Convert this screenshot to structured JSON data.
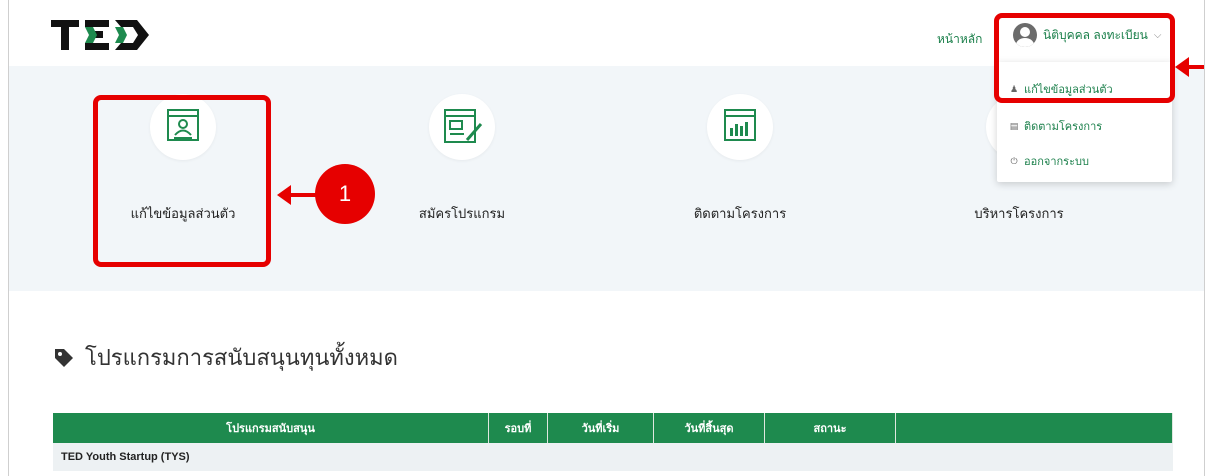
{
  "header": {
    "logo_text": "TED",
    "home_link": "หน้าหลัก",
    "user_name": "นิติบุคคล ลงทะเบียน",
    "user_chevron": "⌵"
  },
  "dropdown": {
    "items": [
      {
        "icon": "user-icon",
        "label": "แก้ไขข้อมูลส่วนตัว"
      },
      {
        "icon": "list-icon",
        "label": "ติดตามโครงการ"
      },
      {
        "icon": "power-icon",
        "label": "ออกจากระบบ"
      }
    ]
  },
  "quick_actions": [
    {
      "icon": "profile-card-icon",
      "label": "แก้ไขข้อมูลส่วนตัว"
    },
    {
      "icon": "edit-form-icon",
      "label": "สมัครโปรแกรม"
    },
    {
      "icon": "chart-board-icon",
      "label": "ติดตามโครงการ"
    },
    {
      "icon": "manage-icon",
      "label": "บริหารโครงการ"
    }
  ],
  "section": {
    "title": "โปรแกรมการสนับสนุนทุนทั้งหมด",
    "icon": "tag-icon"
  },
  "table": {
    "headers": [
      "โปรแกรมสนับสนุน",
      "รอบที่",
      "วันที่เริ่ม",
      "วันที่สิ้นสุด",
      "สถานะ",
      ""
    ],
    "group_row": "TED Youth Startup (TYS)"
  },
  "annotations": {
    "badge_1": "1",
    "colors": {
      "red": "#e60000",
      "green": "#1e8a4e"
    }
  }
}
